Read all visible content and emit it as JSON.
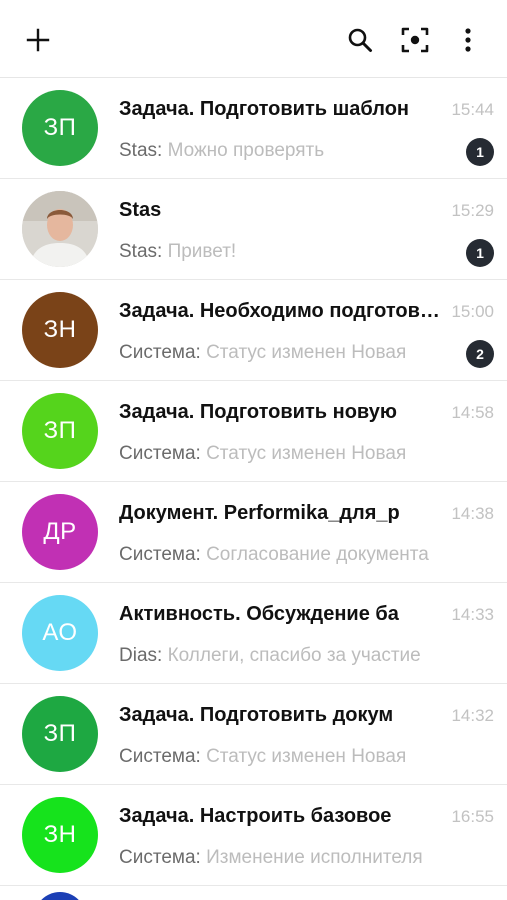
{
  "toolbar": {
    "add_icon": "plus-icon",
    "search_icon": "search-icon",
    "scan_icon": "scan-icon",
    "more_icon": "more-vertical-icon"
  },
  "chats": [
    {
      "initials": "ЗП",
      "avatar_color": "#2aa845",
      "title": "Задача. Подготовить шаблон",
      "time": "15:44",
      "sender": "Stas:",
      "message": "Можно проверять",
      "unread": "1"
    },
    {
      "initials": "",
      "avatar_photo": true,
      "title": "Stas",
      "time": "15:29",
      "sender": "Stas:",
      "message": "Привет!",
      "unread": "1"
    },
    {
      "initials": "ЗН",
      "avatar_color": "#7a4318",
      "title": "Задача. Необходимо подготовить",
      "time": "15:00",
      "sender": "Система:",
      "message": "Статус изменен Новая",
      "unread": "2"
    },
    {
      "initials": "ЗП",
      "avatar_color": "#55d41c",
      "title": "Задача. Подготовить новую",
      "time": "14:58",
      "sender": "Система:",
      "message": "Статус изменен Новая",
      "unread": ""
    },
    {
      "initials": "ДР",
      "avatar_color": "#c130b4",
      "title": "Документ. Performika_для_р",
      "time": "14:38",
      "sender": "Система:",
      "message": "Согласование документа",
      "unread": ""
    },
    {
      "initials": "АО",
      "avatar_color": "#66d9f4",
      "title": "Активность. Обсуждение ба",
      "time": "14:33",
      "sender": "Dias:",
      "message": "Коллеги, спасибо за участие",
      "unread": ""
    },
    {
      "initials": "ЗП",
      "avatar_color": "#1ea842",
      "title": "Задача. Подготовить докум",
      "time": "14:32",
      "sender": "Система:",
      "message": "Статус изменен Новая",
      "unread": ""
    },
    {
      "initials": "ЗН",
      "avatar_color": "#16e31c",
      "title": "Задача. Настроить базовое",
      "time": "16:55",
      "sender": "Система:",
      "message": "Изменение исполнителя",
      "unread": ""
    }
  ],
  "partial_avatar_color": "#1c3fb5"
}
